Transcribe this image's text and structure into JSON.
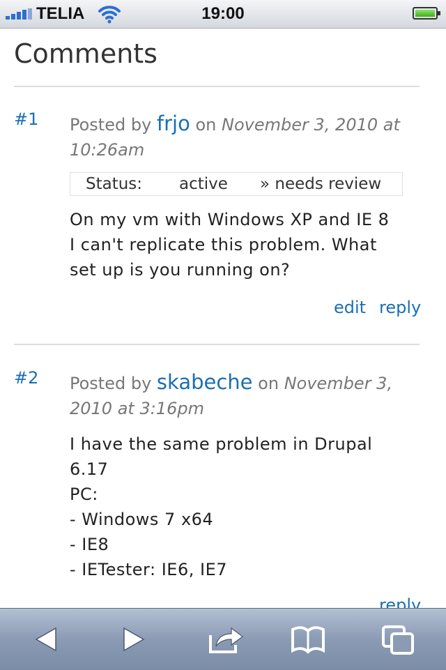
{
  "status_bar": {
    "carrier": "TELIA",
    "time": "19:00"
  },
  "page": {
    "title": "Comments"
  },
  "comments": [
    {
      "number": "#1",
      "posted_by_label": "Posted by",
      "author": "frjo",
      "on_label": "on",
      "date_line1": "November 3, 2010 at",
      "date_line2": "10:26am",
      "status": {
        "label": "Status:",
        "from": "active",
        "to": "» needs review"
      },
      "body": "On my vm with Windows XP and IE 8\nI can't replicate this problem. What\nset up is you running on?",
      "links": {
        "edit": "edit",
        "reply": "reply"
      }
    },
    {
      "number": "#2",
      "posted_by_label": "Posted by",
      "author": "skabeche",
      "on_label": "on",
      "date_line1": "November 3,",
      "date_line2": "2010 at 3:16pm",
      "body": "I have the same problem in Drupal\n6.17\nPC:\n- Windows 7 x64\n- IE8\n- IETester: IE6, IE7",
      "links": {
        "reply": "reply"
      }
    }
  ],
  "toolbar": {
    "icons": [
      "back-arrow-icon",
      "forward-arrow-icon",
      "share-icon",
      "bookmarks-icon",
      "tabs-icon"
    ]
  }
}
